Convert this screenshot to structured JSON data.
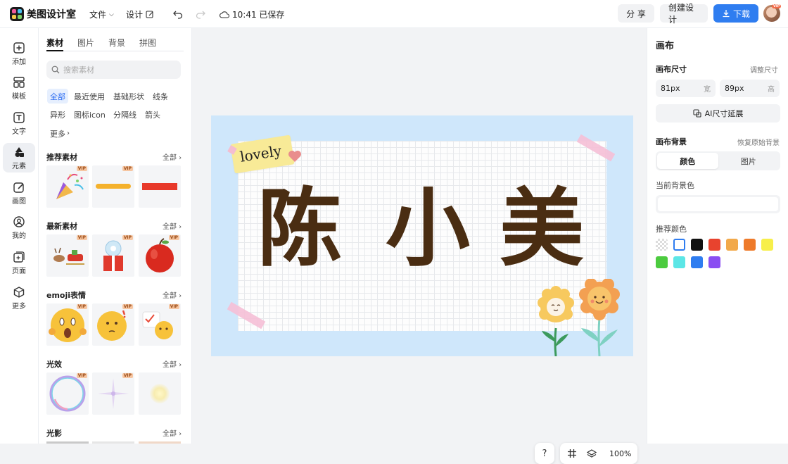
{
  "app": {
    "name": "美图设计室"
  },
  "topbar": {
    "file_menu": "文件",
    "design_menu": "设计",
    "save_status": "10:41 已保存",
    "share_label": "分 享",
    "create_label": "创建设计",
    "download_label": "下载",
    "avatar_badge": "VIP"
  },
  "rail": {
    "items": [
      {
        "label": "添加",
        "icon": "plus-square-icon"
      },
      {
        "label": "模板",
        "icon": "template-icon"
      },
      {
        "label": "文字",
        "icon": "text-icon"
      },
      {
        "label": "元素",
        "icon": "shapes-icon"
      },
      {
        "label": "画图",
        "icon": "pen-icon"
      },
      {
        "label": "我的",
        "icon": "user-icon"
      },
      {
        "label": "页面",
        "icon": "page-icon"
      },
      {
        "label": "更多",
        "icon": "cube-icon"
      }
    ]
  },
  "panel": {
    "tabs": [
      "素材",
      "图片",
      "背景",
      "拼图"
    ],
    "search_placeholder": "搜索素材",
    "chips": [
      "全部",
      "最近使用",
      "基础形状",
      "线条",
      "异形",
      "图标icon",
      "分隔线",
      "箭头",
      "更多"
    ],
    "sections": [
      {
        "title": "推荐素材",
        "all": "全部"
      },
      {
        "title": "最新素材",
        "all": "全部"
      },
      {
        "title": "emoji表情",
        "all": "全部"
      },
      {
        "title": "光效",
        "all": "全部"
      },
      {
        "title": "光影",
        "all": "全部"
      }
    ],
    "vip_label": "VIP"
  },
  "canvas": {
    "sticker_text": "lovely",
    "name_chars": [
      "陈",
      "小",
      "美"
    ]
  },
  "zoom": {
    "help": "?",
    "level": "100%"
  },
  "props": {
    "title": "画布",
    "size_label": "画布尺寸",
    "resize_link": "调整尺寸",
    "width_value": "81px",
    "width_unit": "宽",
    "height_value": "89px",
    "height_unit": "高",
    "ai_extend": "AI尺寸延展",
    "bg_label": "画布背景",
    "restore_link": "恢复原始背景",
    "bg_tabs": [
      "颜色",
      "图片"
    ],
    "current_bg_label": "当前背景色",
    "recommend_label": "推荐颜色",
    "colors": [
      "transparent",
      "#ffffff",
      "#111111",
      "#e8432e",
      "#f2a94a",
      "#ee7a2a",
      "#f7ef4a",
      "#4ccb3f",
      "#5ce6e6",
      "#2f7df0",
      "#8a4ef2"
    ]
  }
}
